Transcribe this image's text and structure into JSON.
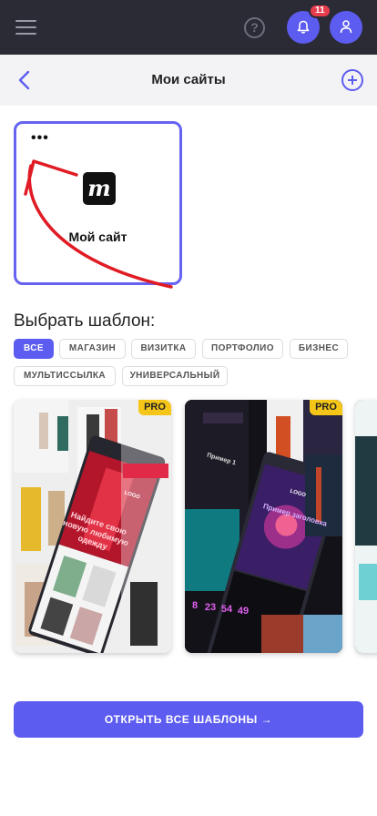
{
  "header": {
    "notifications_count": "11",
    "icons": [
      "menu-icon",
      "help-icon",
      "bell-icon",
      "user-icon"
    ],
    "help_glyph": "?"
  },
  "subheader": {
    "title": "Мои сайты",
    "icons": [
      "back-arrow-icon",
      "add-circle-icon"
    ]
  },
  "site_card": {
    "more_label": "•••",
    "logo_letter": "m",
    "name": "Мой сайт"
  },
  "templates": {
    "title": "Выбрать шаблон:",
    "filters": [
      "ВСЕ",
      "МАГАЗИН",
      "ВИЗИТКА",
      "ПОРТФОЛИО",
      "БИЗНЕС",
      "МУЛЬТИССЫЛКА",
      "УНИВЕРСАЛЬНЫЙ"
    ],
    "active_filter": "ВСЕ",
    "items": [
      {
        "badge": "PRO",
        "logo": "LOGO",
        "headline": "Найдите свою новую любимую одежду"
      },
      {
        "badge": "PRO",
        "logo": "LOGO",
        "heading": "Пример 1",
        "headline": "Пример заголовка",
        "numbers": [
          "8",
          "23",
          "54",
          "49"
        ]
      }
    ],
    "open_all_label": "ОТКРЫТЬ ВСЕ ШАБЛОНЫ →"
  },
  "colors": {
    "accent": "#5d5cf0",
    "topbar": "#2b2b35",
    "badge_red": "#e63d4d",
    "pro_yellow": "#f5c518",
    "annotation_red": "#e01b24"
  }
}
